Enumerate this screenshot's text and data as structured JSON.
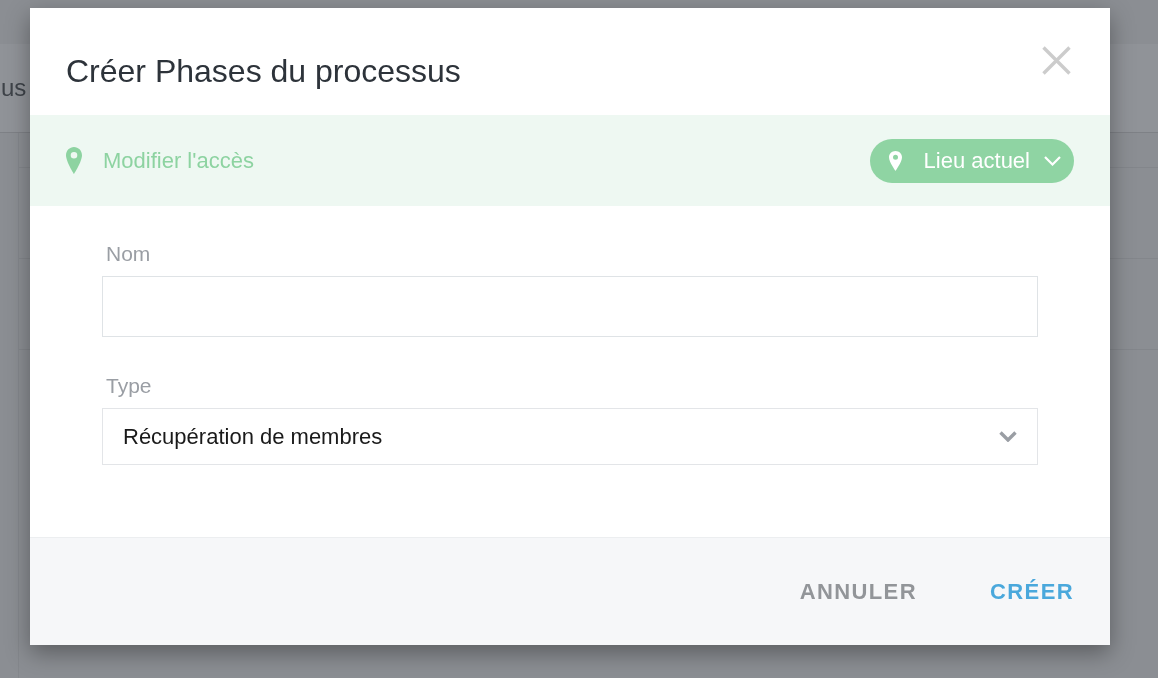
{
  "background": {
    "partial_text": "us"
  },
  "dialog": {
    "title": "Créer Phases du processus"
  },
  "access_bar": {
    "label": "Modifier l'accès",
    "location_button": {
      "label": "Lieu actuel"
    }
  },
  "fields": [
    {
      "kind": "text",
      "label": "Nom"
    },
    {
      "kind": "select",
      "label": "Type",
      "value": "Récupération de membres"
    }
  ],
  "buttons": [
    {
      "kind": "secondary",
      "label": "ANNULER"
    },
    {
      "kind": "primary",
      "label": "CRÉER"
    }
  ]
}
